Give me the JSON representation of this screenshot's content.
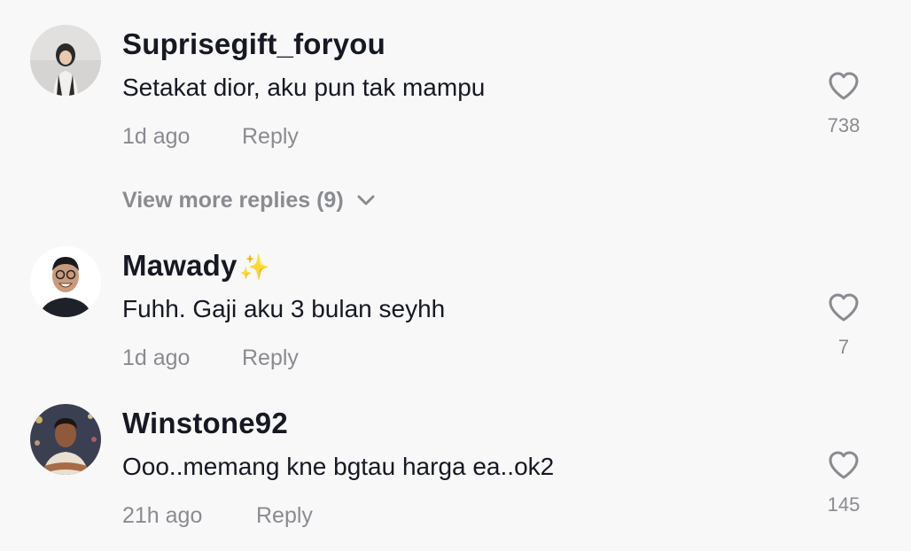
{
  "comments": [
    {
      "username": "Suprisegift_foryou",
      "text": "Setakat dior, aku pun tak mampu",
      "time": "1d ago",
      "reply_label": "Reply",
      "likes": "738",
      "view_more": "View more replies (9)"
    },
    {
      "username": "Mawady",
      "emoji": "✨",
      "text": "Fuhh. Gaji aku 3 bulan seyhh",
      "time": "1d ago",
      "reply_label": "Reply",
      "likes": "7"
    },
    {
      "username": "Winstone92",
      "text": "Ooo..memang kne bgtau harga ea..ok2",
      "time": "21h ago",
      "reply_label": "Reply",
      "likes": "145"
    }
  ],
  "icons": {
    "like": "heart-outline-icon",
    "expand": "chevron-down-icon"
  },
  "colors": {
    "background": "#f8f8f8",
    "primary_text": "#161823",
    "secondary_text": "#8a8b91"
  }
}
